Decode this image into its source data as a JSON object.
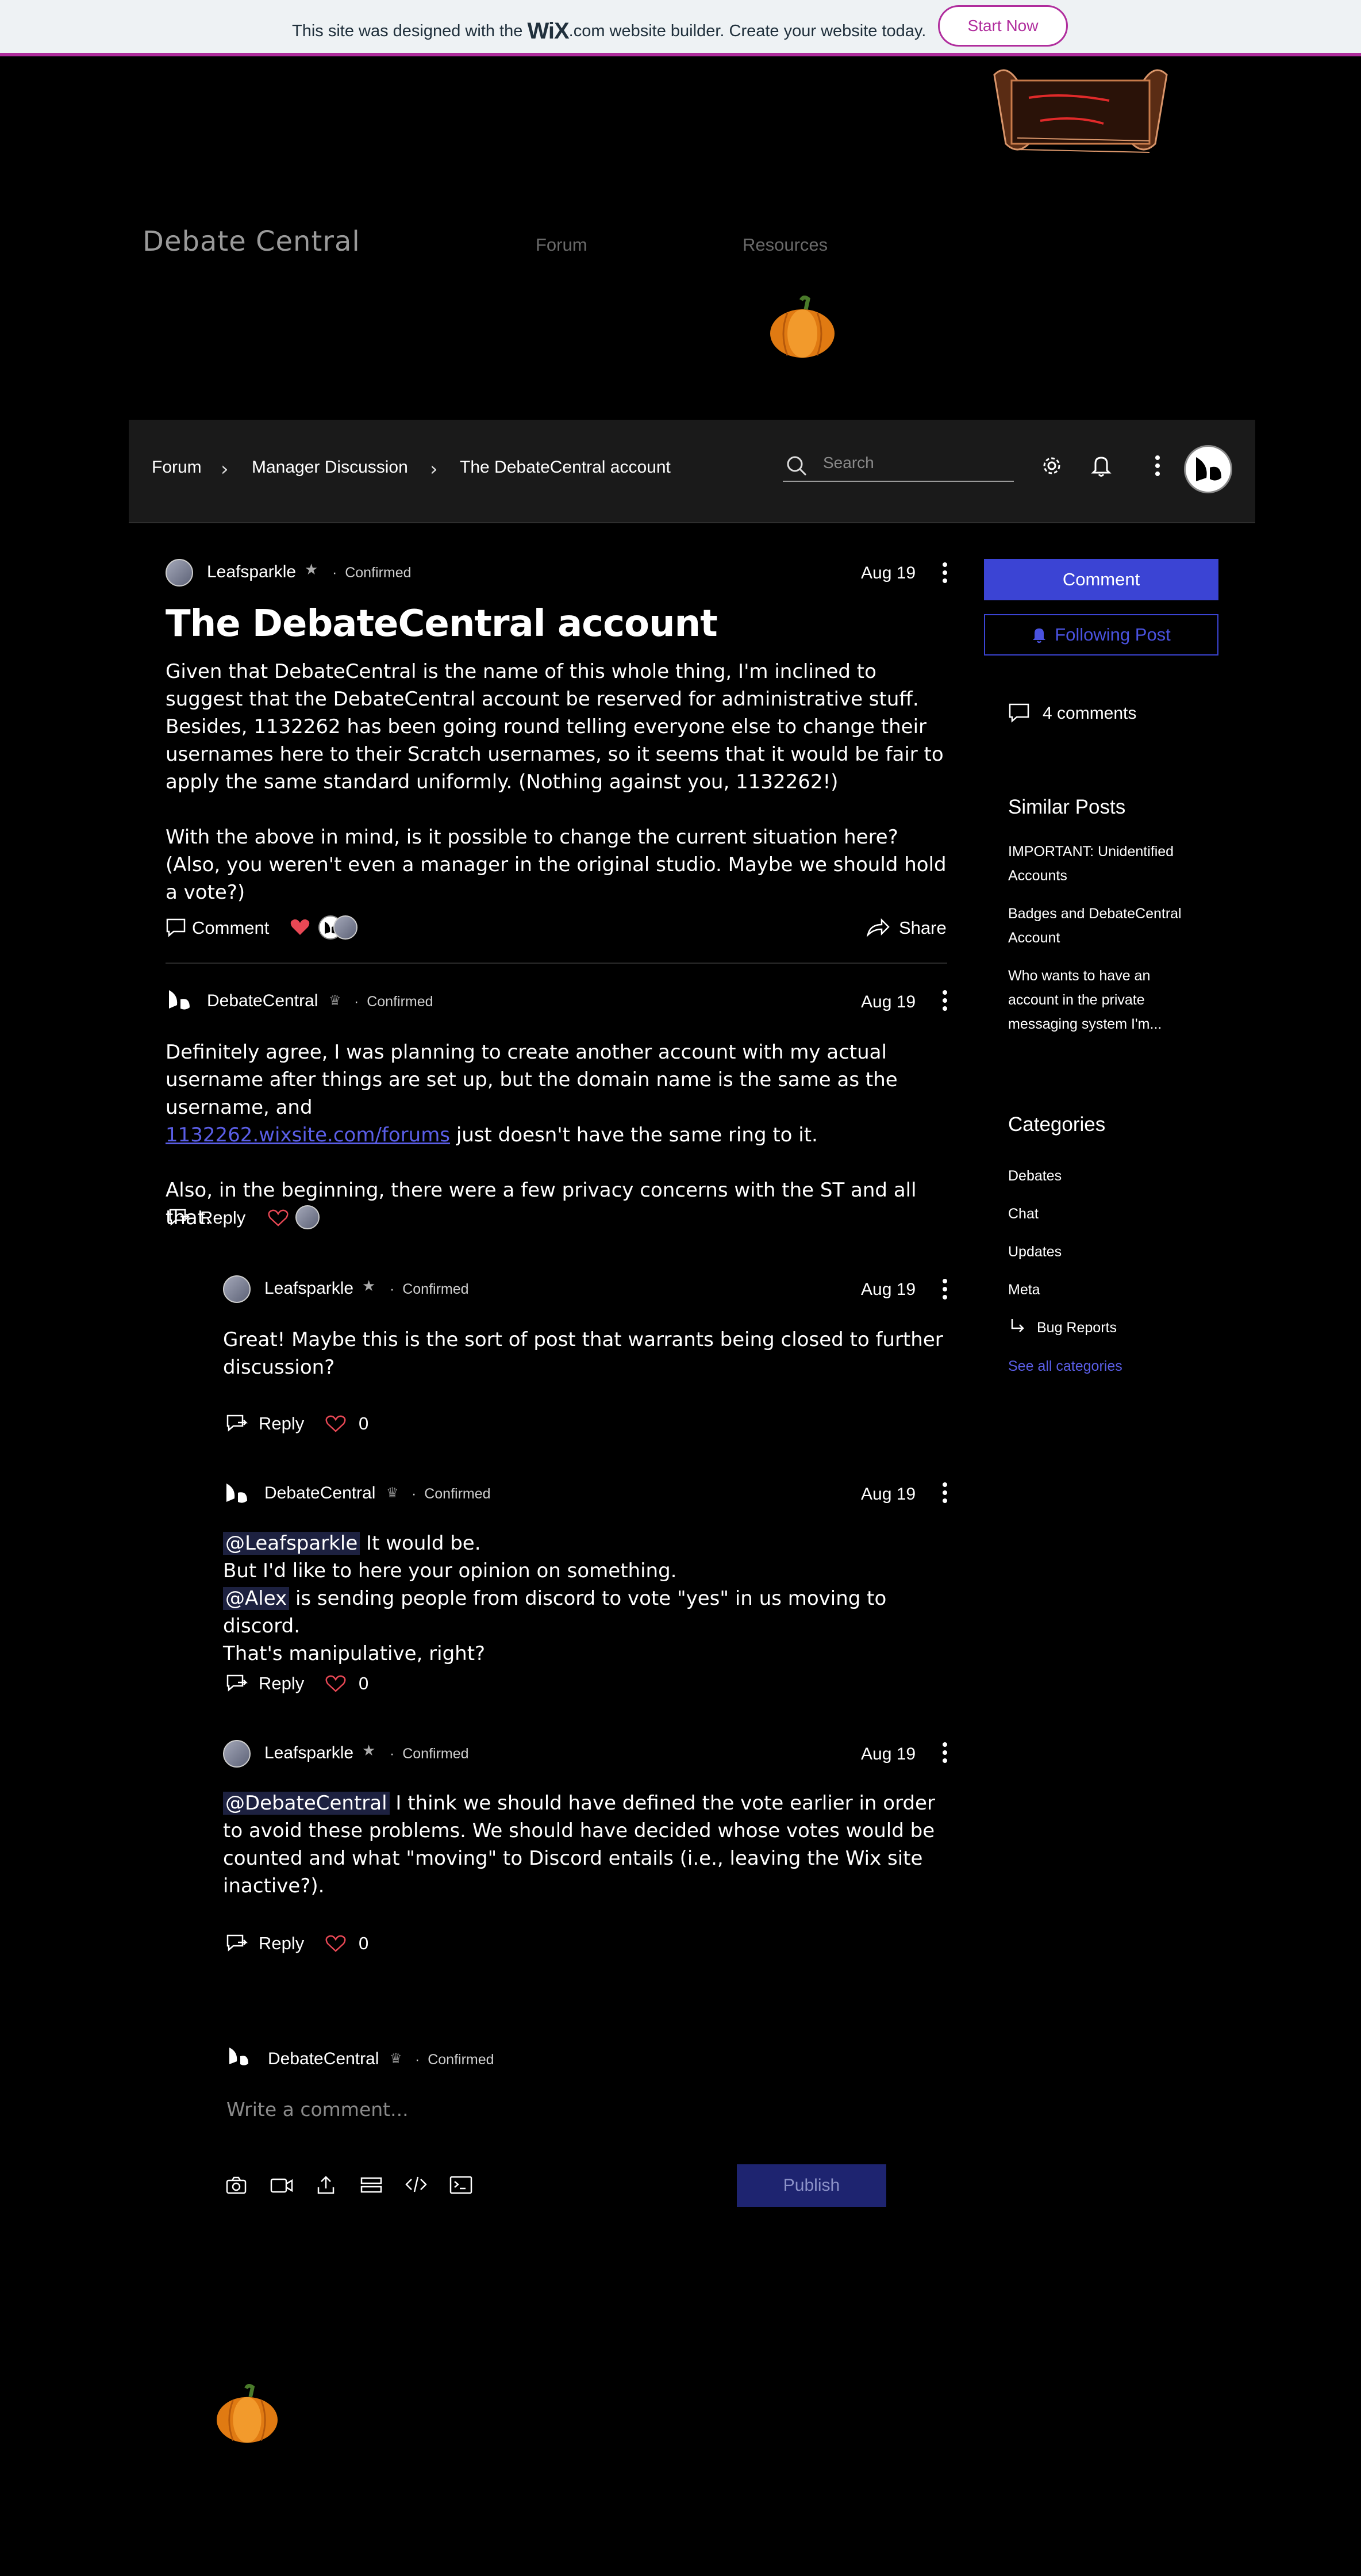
{
  "wix_banner": {
    "text_before": "This site was designed with the",
    "brand": "WiX",
    "text_after": ".com website builder. Create your website today.",
    "cta": "Start Now"
  },
  "header": {
    "site_name": "Debate Central",
    "nav": [
      "Forum",
      "Resources"
    ]
  },
  "toolbar": {
    "breadcrumb": [
      "Forum",
      "Manager Discussion",
      "The DebateCentral account"
    ],
    "search_placeholder": "Search"
  },
  "post": {
    "author": "Leafsparkle",
    "badge": "Confirmed",
    "date": "Aug 19",
    "title": "The DebateCentral account",
    "paragraphs": [
      "Given that DebateCentral is the name of this whole thing, I'm inclined to suggest that the DebateCentral account be reserved for administrative stuff. Besides, 1132262 has been going round telling everyone else to change their usernames here to their Scratch usernames, so it seems that it would be fair to apply the same standard uniformly. (Nothing against you, 1132262!)",
      "With the above in mind, is it possible to change the current situation here? (Also, you weren't even a manager in the original studio. Maybe we should hold a vote?)"
    ],
    "comment_label": "Comment",
    "share_label": "Share"
  },
  "comments": [
    {
      "author": "DebateCentral",
      "badge": "Confirmed",
      "date": "Aug 19",
      "line1": "Definitely agree, I was planning to create another account with my actual username after things are set up, but the domain name is the same as the username, and",
      "link": "1132262.wixsite.com/forums",
      "line1_end": " just doesn't have the same ring to it.",
      "line2": "Also, in the beginning, there were a few privacy concerns with the ST and all that.",
      "reply_label": "Reply"
    }
  ],
  "replies": [
    {
      "author": "Leafsparkle",
      "badge": "Confirmed",
      "date": "Aug 19",
      "text": "Great! Maybe this is the sort of post that warrants being closed to further discussion?",
      "reply_label": "Reply",
      "likes": "0"
    },
    {
      "author": "DebateCentral",
      "badge": "Confirmed",
      "date": "Aug 19",
      "mention1": "@Leafsparkle",
      "text1": " It would be.",
      "text2": "But I'd like to here your opinion on something.",
      "mention2": "@Alex",
      "text3": " is sending people from discord to vote \"yes\" in us moving to discord.",
      "text4": "That's manipulative, right?",
      "reply_label": "Reply",
      "likes": "0"
    },
    {
      "author": "Leafsparkle",
      "badge": "Confirmed",
      "date": "Aug 19",
      "mention": "@DebateCentral",
      "text": " I think we should have defined the vote earlier in order to avoid these problems. We should have decided whose votes would be counted and what \"moving\" to Discord entails (i.e., leaving the Wix site inactive?).",
      "reply_label": "Reply",
      "likes": "0"
    }
  ],
  "composer": {
    "author": "DebateCentral",
    "badge": "Confirmed",
    "placeholder": "Write a comment...",
    "publish": "Publish"
  },
  "sidebar": {
    "comment_button": "Comment",
    "follow_button": "Following Post",
    "comments_count": "4 comments",
    "similar_title": "Similar Posts",
    "similar": [
      [
        "IMPORTANT: Unidentified",
        "Accounts"
      ],
      [
        "Badges and DebateCentral",
        "Account"
      ],
      [
        "Who wants to have an",
        "account in the private",
        "messaging system I'm..."
      ]
    ],
    "categories_title": "Categories",
    "categories": [
      "Debates",
      "Chat",
      "Updates",
      "Meta",
      "Bug Reports"
    ],
    "see_all": "See all categories"
  },
  "colors": {
    "accent": "#3b44d4",
    "wix_magenta": "#b02d9d",
    "like_red": "#e84855"
  }
}
